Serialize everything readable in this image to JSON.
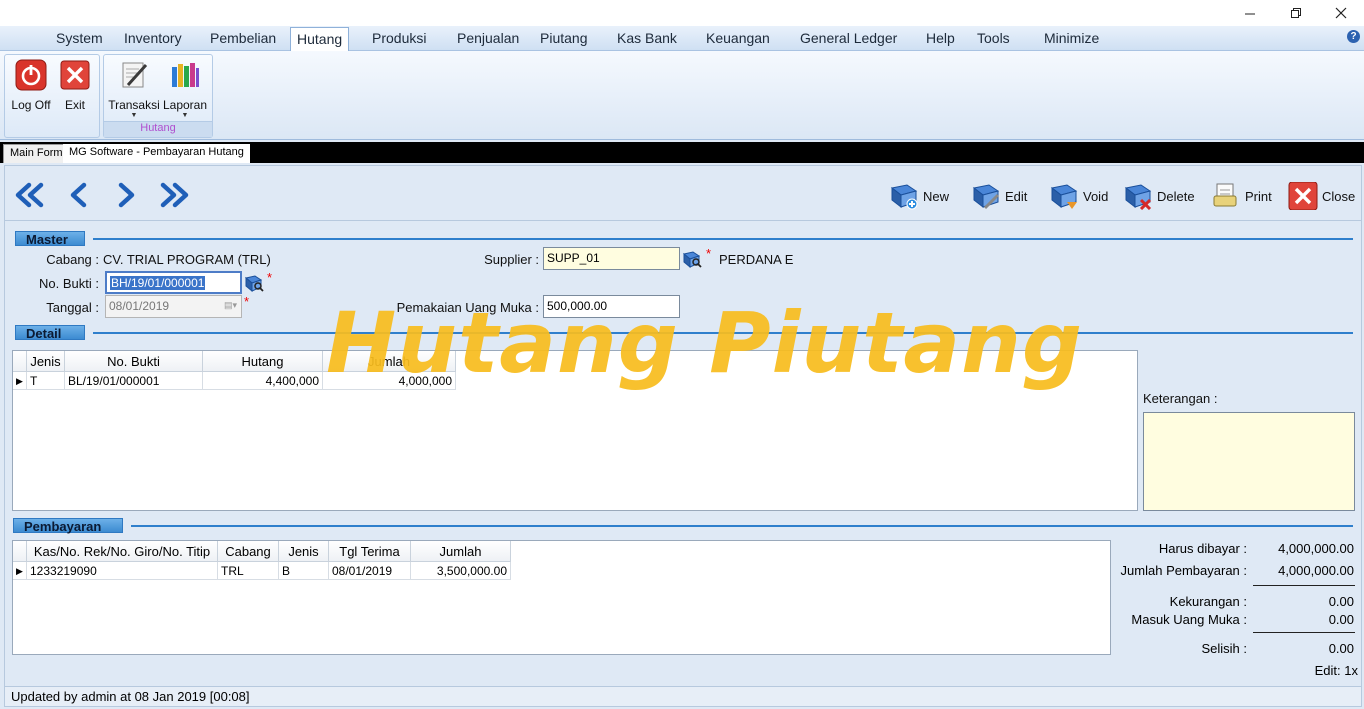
{
  "window": {
    "minimize": "—",
    "restore": "❐",
    "close": "✕"
  },
  "menu": {
    "items": [
      {
        "label": "System",
        "active": false
      },
      {
        "label": "Inventory",
        "active": false
      },
      {
        "label": "Pembelian",
        "active": false
      },
      {
        "label": "Hutang",
        "active": true
      },
      {
        "label": "Produksi",
        "active": false
      },
      {
        "label": "Penjualan",
        "active": false
      },
      {
        "label": "Piutang",
        "active": false
      },
      {
        "label": "Kas Bank",
        "active": false
      },
      {
        "label": "Keuangan",
        "active": false
      },
      {
        "label": "General Ledger",
        "active": false
      },
      {
        "label": "Help",
        "active": false
      },
      {
        "label": "Tools",
        "active": false
      },
      {
        "label": "Minimize",
        "active": false
      }
    ],
    "help_icon": "?"
  },
  "ribbon": {
    "logoff": "Log Off",
    "exit": "Exit",
    "transaksi": "Transaksi",
    "laporan": "Laporan",
    "group_caption": "Hutang"
  },
  "tabs": {
    "main_form": "Main Form",
    "active": "MG Software - Pembayaran Hutang"
  },
  "toolbar": {
    "new": "New",
    "edit": "Edit",
    "void": "Void",
    "delete": "Delete",
    "print": "Print",
    "close": "Close"
  },
  "master": {
    "section": "Master",
    "cabang_label": "Cabang :",
    "cabang_value": "CV. TRIAL PROGRAM (TRL)",
    "nobukti_label": "No. Bukti :",
    "nobukti_value": "BH/19/01/000001",
    "tanggal_label": "Tanggal :",
    "tanggal_value": "08/01/2019",
    "supplier_label": "Supplier :",
    "supplier_value": "SUPP_01",
    "supplier_name": "PERDANA E",
    "uangmuka_label": "Pemakaian Uang Muka :",
    "uangmuka_value": "500,000.00",
    "required_mark": "*"
  },
  "detail": {
    "section": "Detail",
    "columns": [
      "Jenis",
      "No. Bukti",
      "Hutang",
      "Jumlah"
    ],
    "rows": [
      {
        "jenis": "T",
        "nobukti": "BL/19/01/000001",
        "hutang": "4,400,000",
        "jumlah": "4,000,000"
      }
    ],
    "keterangan_label": "Keterangan :"
  },
  "pembayaran": {
    "section": "Pembayaran",
    "columns": [
      "Kas/No. Rek/No. Giro/No. Titip",
      "Cabang",
      "Jenis",
      "Tgl Terima",
      "Jumlah"
    ],
    "rows": [
      {
        "kas": "1233219090",
        "cabang": "TRL",
        "jenis": "B",
        "tgl": "08/01/2019",
        "jumlah": "3,500,000.00"
      }
    ]
  },
  "summary": {
    "harus_label": "Harus dibayar :",
    "harus_value": "4,000,000.00",
    "jumlah_label": "Jumlah Pembayaran :",
    "jumlah_value": "4,000,000.00",
    "kurang_label": "Kekurangan :",
    "kurang_value": "0.00",
    "masuk_label": "Masuk Uang Muka :",
    "masuk_value": "0.00",
    "selisih_label": "Selisih :",
    "selisih_value": "0.00",
    "edit_count": "Edit: 1x"
  },
  "status": {
    "text": "Updated by admin at 08 Jan 2019 [00:08]"
  },
  "watermark": "Hutang Piutang"
}
